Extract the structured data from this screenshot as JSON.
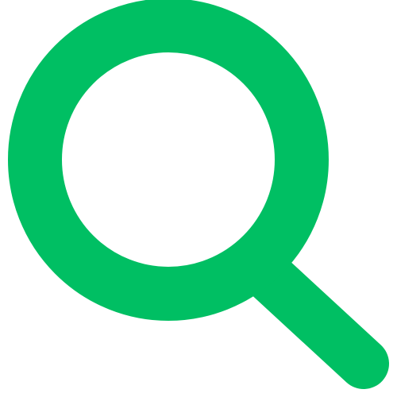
{
  "icon": {
    "name": "search-icon",
    "color": "#00BF63",
    "background": "#FFFFFF"
  }
}
